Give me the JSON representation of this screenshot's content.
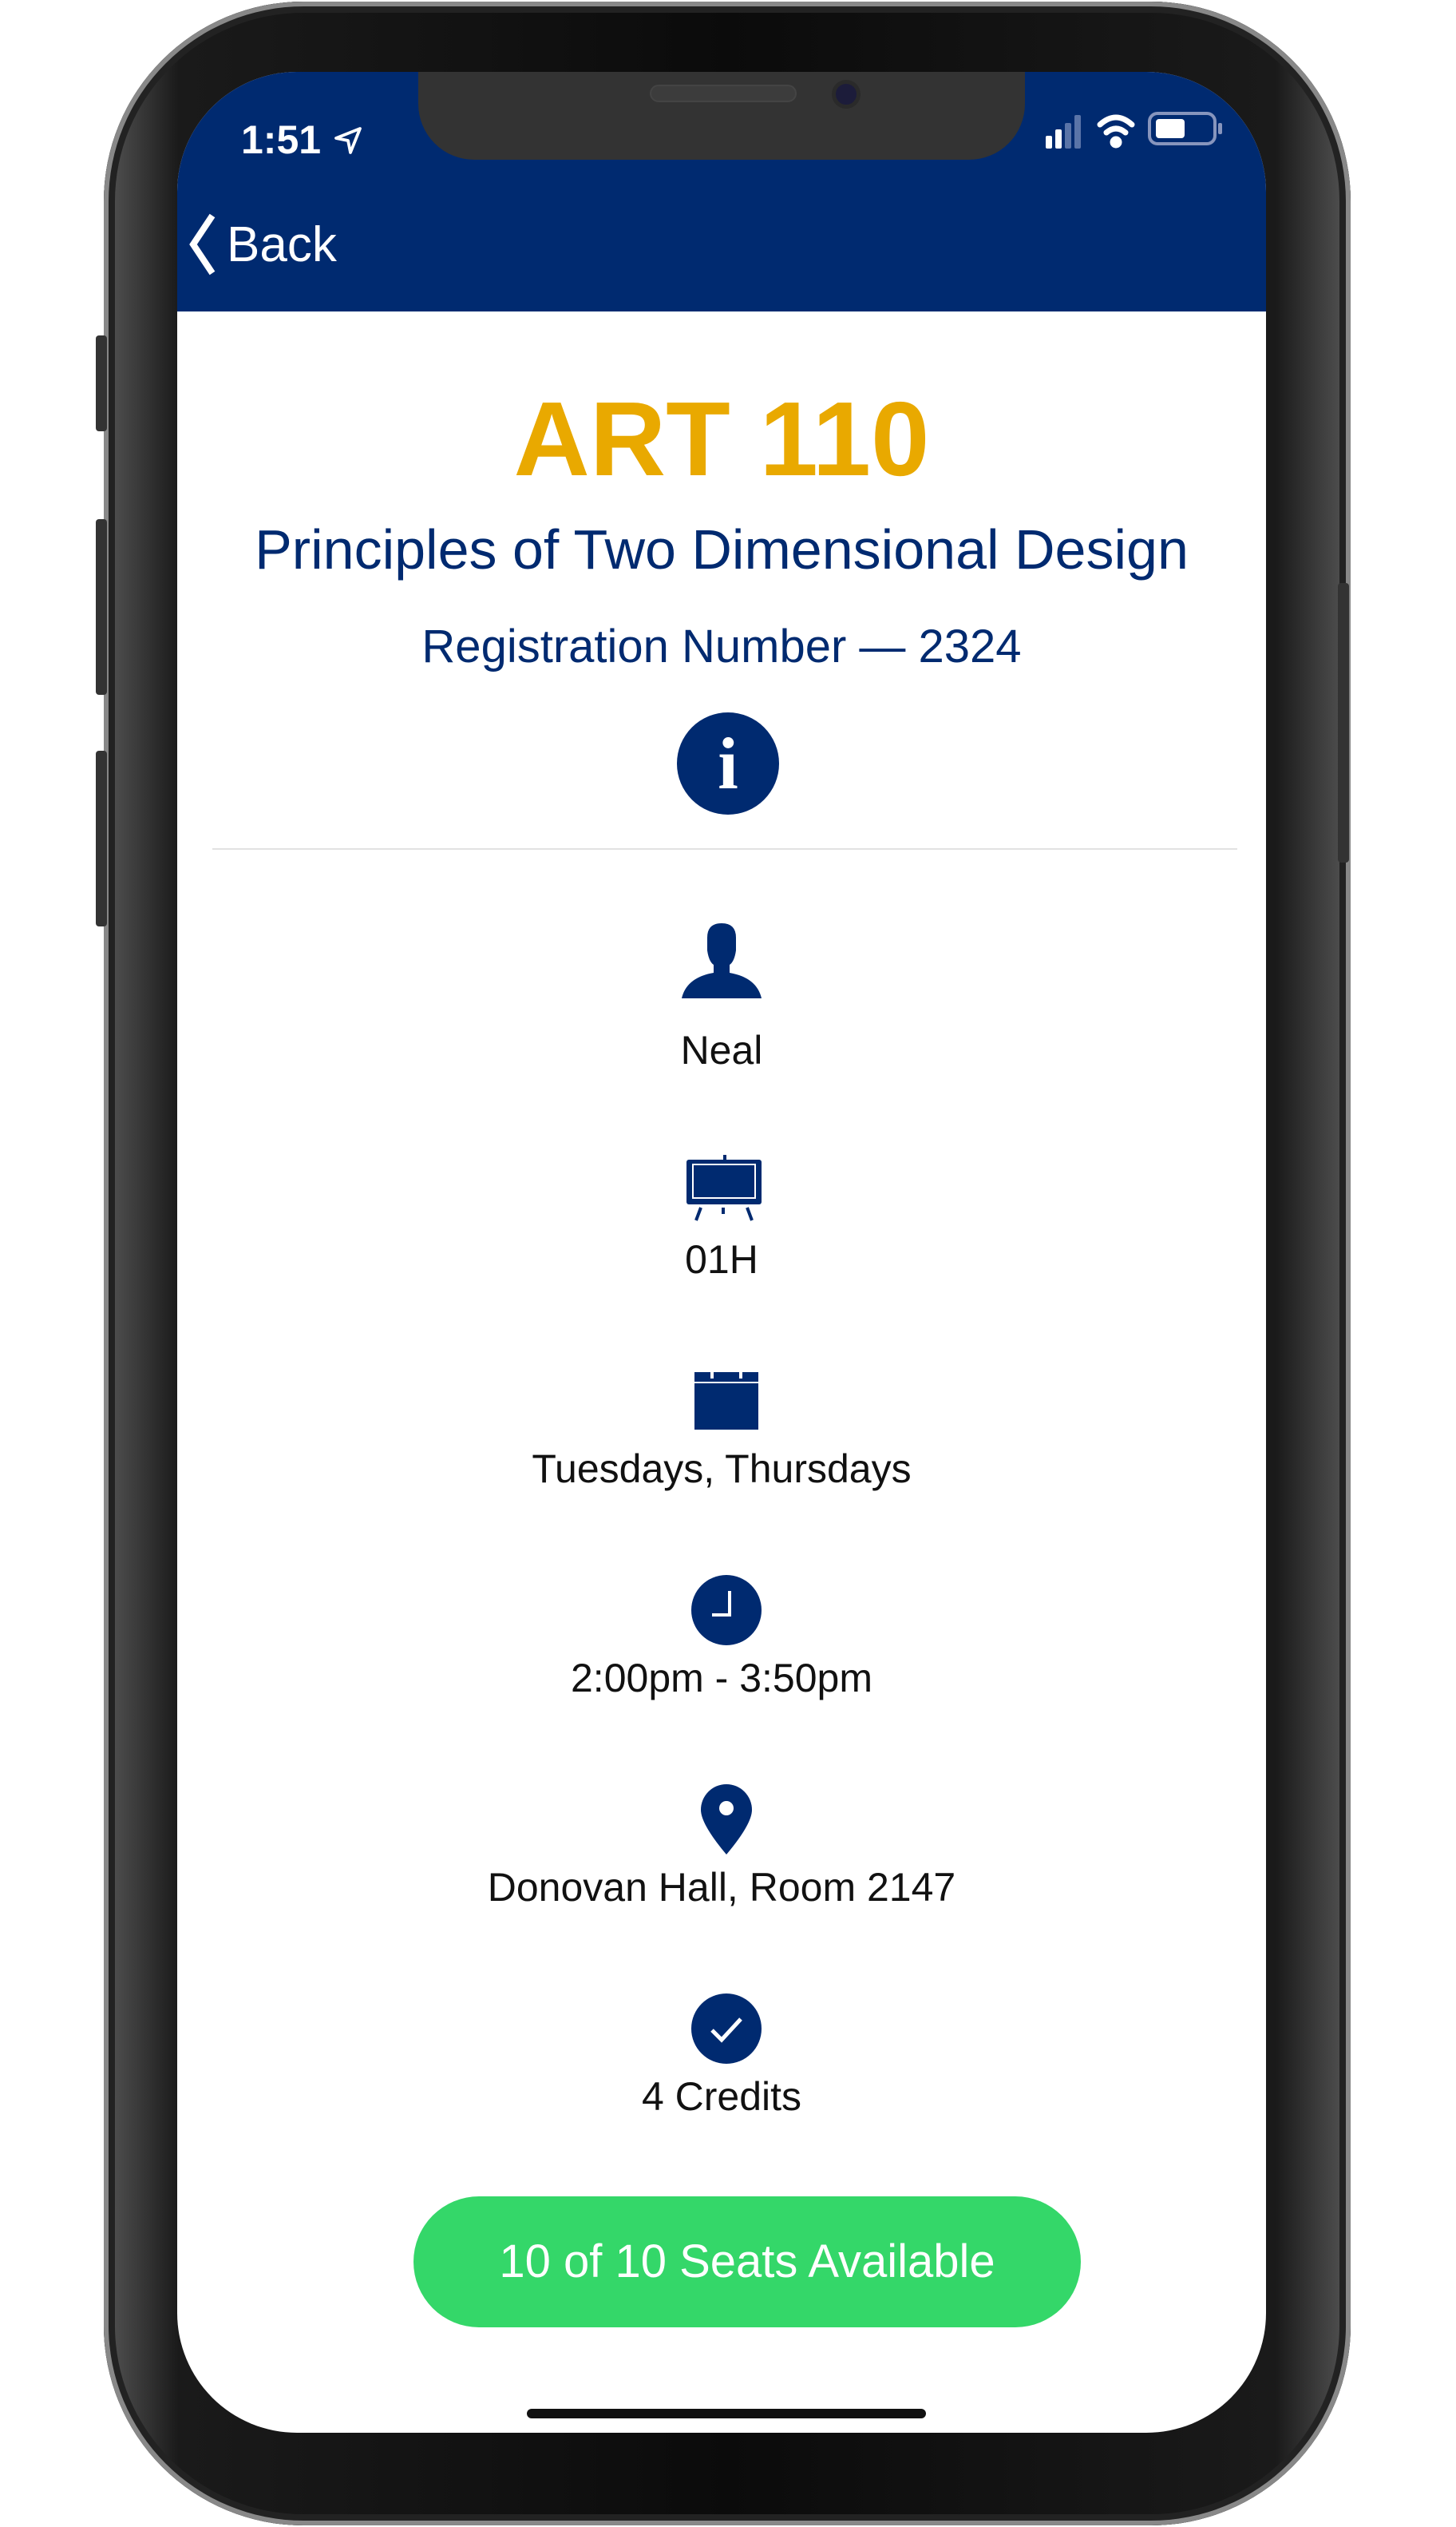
{
  "status_bar": {
    "time": "1:51",
    "icons": [
      "location-arrow-icon",
      "signal-icon",
      "wifi-icon",
      "battery-icon"
    ]
  },
  "nav": {
    "back_label": "Back"
  },
  "course": {
    "code": "ART 110",
    "title": "Principles of Two Dimensional Design",
    "registration": "Registration Number — 2324"
  },
  "details": [
    {
      "icon": "person-icon",
      "text": "Neal"
    },
    {
      "icon": "classroom-board-icon",
      "text": "01H"
    },
    {
      "icon": "calendar-icon",
      "text": "Tuesdays, Thursdays"
    },
    {
      "icon": "clock-icon",
      "text": "2:00pm - 3:50pm"
    },
    {
      "icon": "map-pin-icon",
      "text": "Donovan Hall, Room 2147"
    },
    {
      "icon": "check-circle-icon",
      "text": "4 Credits"
    }
  ],
  "seats_button": "10 of 10 Seats Available",
  "colors": {
    "nav": "#002A70",
    "code": "#E9A900",
    "seats": "#34D769"
  }
}
